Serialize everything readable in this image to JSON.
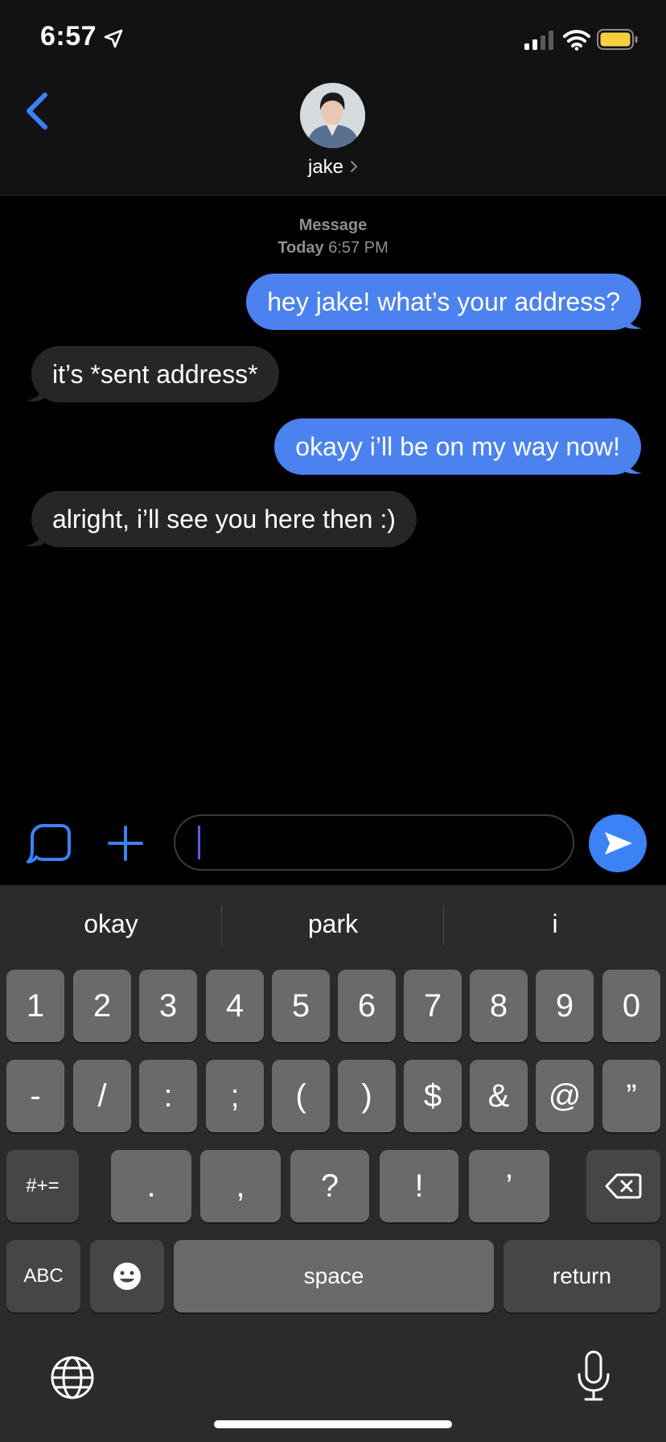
{
  "status_bar": {
    "time": "6:57"
  },
  "header": {
    "contact_name": "jake"
  },
  "thread": {
    "meta_label": "Message",
    "meta_day": "Today",
    "meta_time": "6:57 PM",
    "messages": [
      {
        "direction": "sent",
        "text": "hey jake! what’s your address?"
      },
      {
        "direction": "received",
        "text": "it’s *sent address*"
      },
      {
        "direction": "sent",
        "text": "okayy i’ll be on my way now!"
      },
      {
        "direction": "received",
        "text": "alright, i’ll see you here then :)"
      }
    ]
  },
  "input": {
    "value": ""
  },
  "keyboard": {
    "suggestions": [
      "okay",
      "park",
      "i"
    ],
    "row1": [
      "1",
      "2",
      "3",
      "4",
      "5",
      "6",
      "7",
      "8",
      "9",
      "0"
    ],
    "row2": [
      "-",
      "/",
      ":",
      ";",
      "(",
      ")",
      "$",
      "&",
      "@",
      "”"
    ],
    "row3_left": "#+=",
    "row3": [
      ".",
      ",",
      "?",
      "!",
      "’"
    ],
    "abc": "ABC",
    "space": "space",
    "return": "return"
  },
  "colors": {
    "sent_bubble": "#4b82f0",
    "received_bubble": "#262628",
    "accent": "#3a82f6"
  }
}
